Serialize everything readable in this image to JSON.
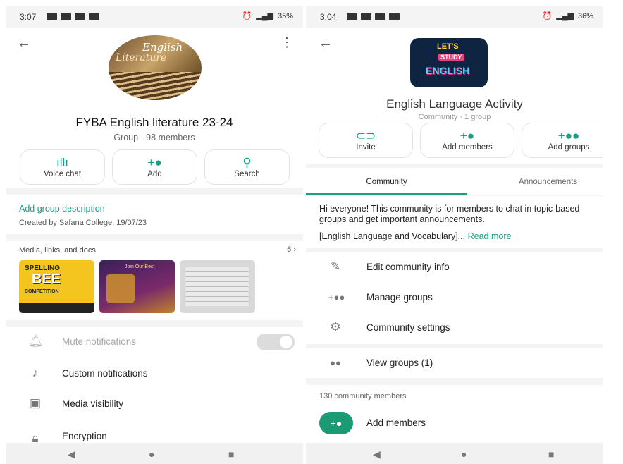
{
  "left": {
    "status": {
      "time": "3:07",
      "battery": "35%"
    },
    "group_name": "FYBA English literature 23-24",
    "group_meta": "Group · 98 members",
    "avatar_text": {
      "line1": "English",
      "line2": "Literature"
    },
    "actions": [
      {
        "label": "Voice chat",
        "icon": "voice-wave-icon"
      },
      {
        "label": "Add",
        "icon": "add-person-icon"
      },
      {
        "label": "Search",
        "icon": "search-icon"
      }
    ],
    "add_description": "Add group description",
    "created_by": "Created by Safana College, 19/07/23",
    "media": {
      "title": "Media, links, and docs",
      "count": "6"
    },
    "thumbs": {
      "t1_line1": "SPELLING",
      "t1_line2": "BEE",
      "t1_line3": "COMPETITION",
      "t2_line1": "Join Our Best"
    },
    "settings": [
      {
        "label": "Mute notifications",
        "icon": "bell-icon"
      },
      {
        "label": "Custom notifications",
        "icon": "music-note-icon"
      },
      {
        "label": "Media visibility",
        "icon": "image-icon"
      },
      {
        "label": "Encryption",
        "icon": "lock-icon"
      }
    ]
  },
  "right": {
    "status": {
      "time": "3:04",
      "battery": "36%"
    },
    "avatar_text": {
      "line1": "LET'S",
      "line2": "STUDY",
      "line3": "ENGLISH"
    },
    "community_name": "English Language Activity",
    "community_meta": "Community · 1 group",
    "actions": [
      {
        "label": "Invite",
        "icon": "link-icon"
      },
      {
        "label": "Add members",
        "icon": "add-person-icon"
      },
      {
        "label": "Add groups",
        "icon": "add-group-icon"
      }
    ],
    "tabs": [
      {
        "label": "Community",
        "active": true
      },
      {
        "label": "Announcements",
        "active": false
      }
    ],
    "description": "Hi everyone! This community is for members to chat in topic-based groups and get important announcements.",
    "description_more": "[English Language and Vocabulary]...",
    "read_more": "Read more",
    "menu": [
      {
        "label": "Edit community info",
        "icon": "pencil-icon"
      },
      {
        "label": "Manage groups",
        "icon": "manage-groups-icon"
      },
      {
        "label": "Community settings",
        "icon": "gear-icon"
      },
      {
        "label": "View groups (1)",
        "icon": "people-icon"
      }
    ],
    "members_count": "130 community members",
    "add_members": "Add members"
  },
  "colors": {
    "accent": "#16a085",
    "accent_dark": "#1a9b74",
    "text": "#222222",
    "muted": "#777777"
  }
}
